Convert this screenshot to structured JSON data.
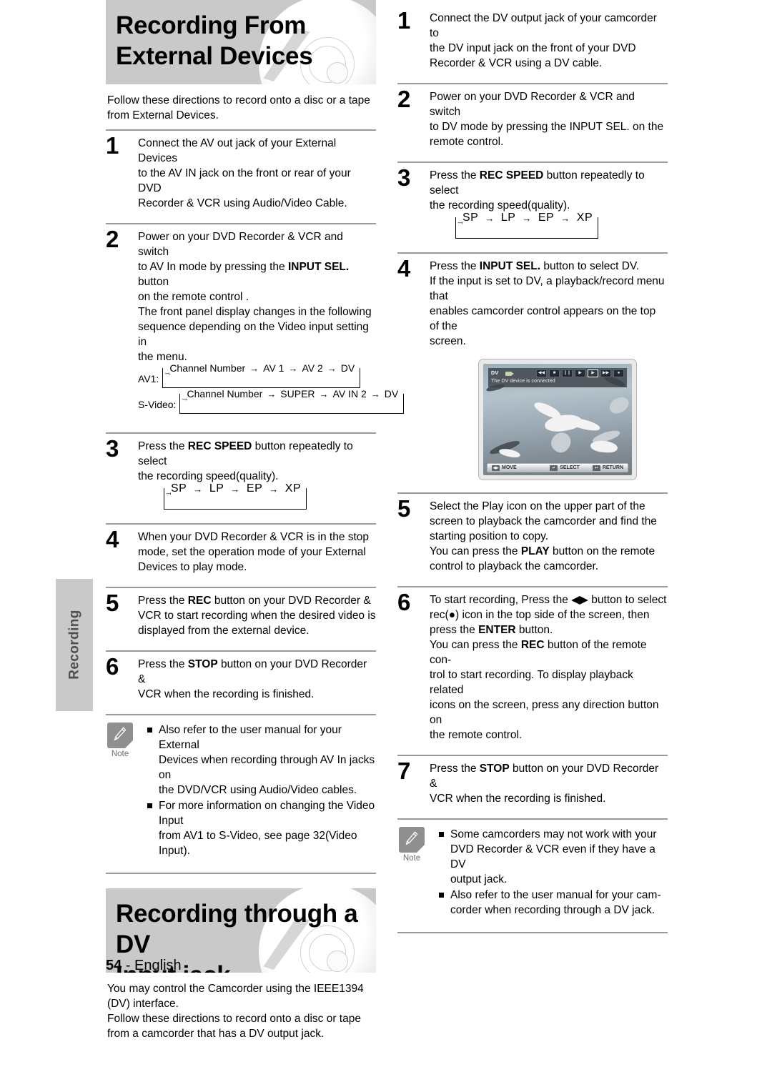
{
  "side_tab": {
    "label": "Recording"
  },
  "footer": {
    "page_number": "54",
    "separator": "-",
    "language": "English"
  },
  "left_column": {
    "heading": "Recording From\nExternal Devices",
    "intro": "Follow these directions to record onto a disc or a tape\nfrom External Devices.",
    "steps": [
      {
        "number": "1",
        "text_parts": [
          {
            "t": "Connect the AV out jack of your External Devices\nto the AV IN jack on the front or rear of your DVD\nRecorder & VCR using Audio/Video Cable.",
            "b": false
          }
        ]
      },
      {
        "number": "2",
        "text_parts": [
          {
            "t": "Power on your DVD Recorder & VCR and switch\nto AV In mode by pressing the ",
            "b": false
          },
          {
            "t": "INPUT SEL.",
            "b": true
          },
          {
            "t": " button\non the remote control .\nThe front panel display changes in the following\nsequence depending on the Video input setting in\nthe menu.",
            "b": false
          }
        ],
        "sequences": [
          {
            "label": "AV1:",
            "items": [
              "Channel Number",
              "AV 1",
              "AV 2",
              "DV"
            ]
          },
          {
            "label": "S-Video:",
            "items": [
              "Channel Number",
              "SUPER",
              "AV IN 2",
              "DV"
            ]
          }
        ]
      },
      {
        "number": "3",
        "text_parts": [
          {
            "t": "Press the ",
            "b": false
          },
          {
            "t": "REC SPEED",
            "b": true
          },
          {
            "t": " button repeatedly to select\nthe recording speed(quality).",
            "b": false
          }
        ],
        "speed_loop": [
          "SP",
          "LP",
          "EP",
          "XP"
        ]
      },
      {
        "number": "4",
        "text_parts": [
          {
            "t": "When your DVD Recorder & VCR is in the stop\nmode, set the operation mode of your External\nDevices to play mode.",
            "b": false
          }
        ]
      },
      {
        "number": "5",
        "text_parts": [
          {
            "t": "Press the ",
            "b": false
          },
          {
            "t": "REC",
            "b": true
          },
          {
            "t": " button on your DVD Recorder &\nVCR to start recording when the desired video is\ndisplayed from the external device.",
            "b": false
          }
        ]
      },
      {
        "number": "6",
        "text_parts": [
          {
            "t": "Press the ",
            "b": false
          },
          {
            "t": "STOP",
            "b": true
          },
          {
            "t": " button on your DVD Recorder &\nVCR when the recording is finished.",
            "b": false
          }
        ]
      }
    ],
    "note": {
      "label": "Note",
      "items": [
        "Also refer to the user manual for your External\nDevices when recording through AV In jacks on\nthe DVD/VCR using Audio/Video cables.",
        "For more information on changing the Video Input\nfrom AV1 to S-Video, see page 32(Video Input)."
      ]
    },
    "heading2": "Recording through a DV\nInput jack",
    "intro2": "You may control the Camcorder using the IEEE1394\n(DV) interface.\nFollow these directions to record onto a disc or tape\nfrom a camcorder that has a DV output jack."
  },
  "right_column": {
    "steps": [
      {
        "number": "1",
        "text_parts": [
          {
            "t": "Connect the DV output jack of your camcorder to\nthe DV input jack on the front of your DVD\nRecorder & VCR using a DV cable.",
            "b": false
          }
        ]
      },
      {
        "number": "2",
        "text_parts": [
          {
            "t": "Power on your DVD Recorder & VCR and switch\nto DV mode by pressing the INPUT SEL. on the\nremote control.",
            "b": false
          }
        ]
      },
      {
        "number": "3",
        "text_parts": [
          {
            "t": "Press the ",
            "b": false
          },
          {
            "t": "REC SPEED",
            "b": true
          },
          {
            "t": " button repeatedly to select\nthe recording speed(quality).",
            "b": false
          }
        ],
        "speed_loop": [
          "SP",
          "LP",
          "EP",
          "XP"
        ]
      },
      {
        "number": "4",
        "text_parts": [
          {
            "t": "Press the ",
            "b": false
          },
          {
            "t": "INPUT SEL.",
            "b": true
          },
          {
            "t": " button to select DV.\nIf the input is set to DV, a playback/record menu that\nenables camcorder control appears on the top of the\nscreen.",
            "b": false
          }
        ]
      },
      {
        "number": "5",
        "text_parts": [
          {
            "t": "Select the Play icon on the upper part of the\nscreen to playback the camcorder and find the\nstarting position to copy.\nYou can press the ",
            "b": false
          },
          {
            "t": "PLAY",
            "b": true
          },
          {
            "t": " button on the remote\ncontrol to playback the camcorder.",
            "b": false
          }
        ]
      },
      {
        "number": "6",
        "text_parts": [
          {
            "t": "To start recording, Press the ◀▶ button to select\nrec(●) icon in the top side of the screen, then\npress the ",
            "b": false
          },
          {
            "t": "ENTER",
            "b": true
          },
          {
            "t": " button.\nYou can press the ",
            "b": false
          },
          {
            "t": "REC",
            "b": true
          },
          {
            "t": " button of the remote con-\ntrol to start recording. To display playback related\nicons on the screen, press any direction button on\nthe remote control.",
            "b": false
          }
        ]
      },
      {
        "number": "7",
        "text_parts": [
          {
            "t": "Press the ",
            "b": false
          },
          {
            "t": "STOP",
            "b": true
          },
          {
            "t": " button on your DVD Recorder &\nVCR when the recording is finished.",
            "b": false
          }
        ]
      }
    ],
    "tv_screen": {
      "osd_title": "DV",
      "osd_message": "The DV device is connected",
      "transport_buttons": [
        {
          "name": "rewind",
          "glyph": "◀◀",
          "selected": false
        },
        {
          "name": "stop",
          "glyph": "■",
          "selected": false
        },
        {
          "name": "pause",
          "glyph": "❙❙",
          "selected": false
        },
        {
          "name": "slow-play",
          "glyph": "▶",
          "selected": false
        },
        {
          "name": "play",
          "glyph": "▶",
          "selected": true
        },
        {
          "name": "fast-forward",
          "glyph": "▶▶",
          "selected": false
        },
        {
          "name": "record",
          "glyph": "●",
          "selected": false
        }
      ],
      "footer_keys": [
        {
          "key": "◀▶",
          "label": "MOVE"
        },
        {
          "key": "↵",
          "label": "SELECT"
        },
        {
          "key": "↩",
          "label": "RETURN"
        }
      ]
    },
    "note": {
      "label": "Note",
      "items": [
        "Some camcorders may not work with your\nDVD Recorder & VCR even if they have a DV\noutput jack.",
        "Also refer to the user manual for your cam-\ncorder when recording through a DV jack."
      ]
    }
  }
}
